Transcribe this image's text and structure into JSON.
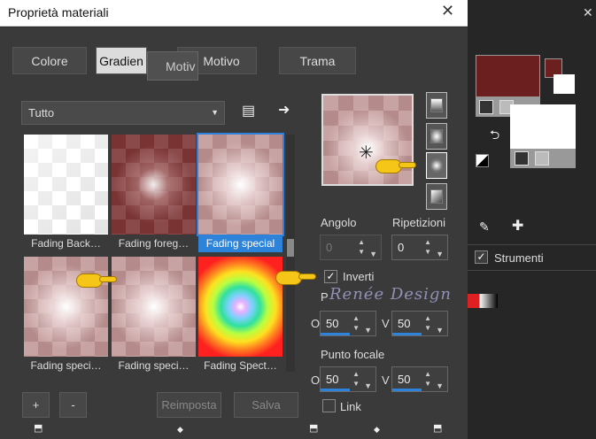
{
  "window": {
    "title": "Proprietà materiali",
    "close_label": "✕"
  },
  "tabs": [
    "Colore",
    "Gradien",
    "Motivo",
    "Trama"
  ],
  "tab_overlay": "Motiv",
  "category_dropdown": "Tutto",
  "gradients": [
    {
      "label": "Fading Back…",
      "style": "white"
    },
    {
      "label": "Fading foreg…",
      "style": "maroon"
    },
    {
      "label": "Fading special",
      "style": "pink",
      "selected": true
    },
    {
      "label": "Fading speci…",
      "style": "pink"
    },
    {
      "label": "Fading speci…",
      "style": "pink"
    },
    {
      "label": "Fading Spect…",
      "style": "spectrum"
    }
  ],
  "buttons": {
    "add": "+",
    "remove": "-",
    "reset": "Reimposta",
    "save": "Salva"
  },
  "angle": {
    "label": "Angolo",
    "value": "0"
  },
  "repeats": {
    "label": "Ripetizioni",
    "value": "0"
  },
  "invert": {
    "label": "Inverti",
    "checked": true
  },
  "center": {
    "label": "P",
    "h_prefix": "O",
    "v_prefix": "V",
    "h": "50",
    "v": "50"
  },
  "focal": {
    "label": "Punto focale",
    "h_prefix": "O",
    "v_prefix": "V",
    "h": "50",
    "v": "50"
  },
  "link": {
    "label": "Link",
    "checked": false
  },
  "watermark": "Renée Design",
  "right_panel": {
    "close_label": "✕",
    "tools_label": "Strumenti",
    "tools_checked": true
  },
  "colors": {
    "foreground": "#6b1f1f",
    "accent": "#2d83d9",
    "spectrum_chip": "#e02020"
  }
}
